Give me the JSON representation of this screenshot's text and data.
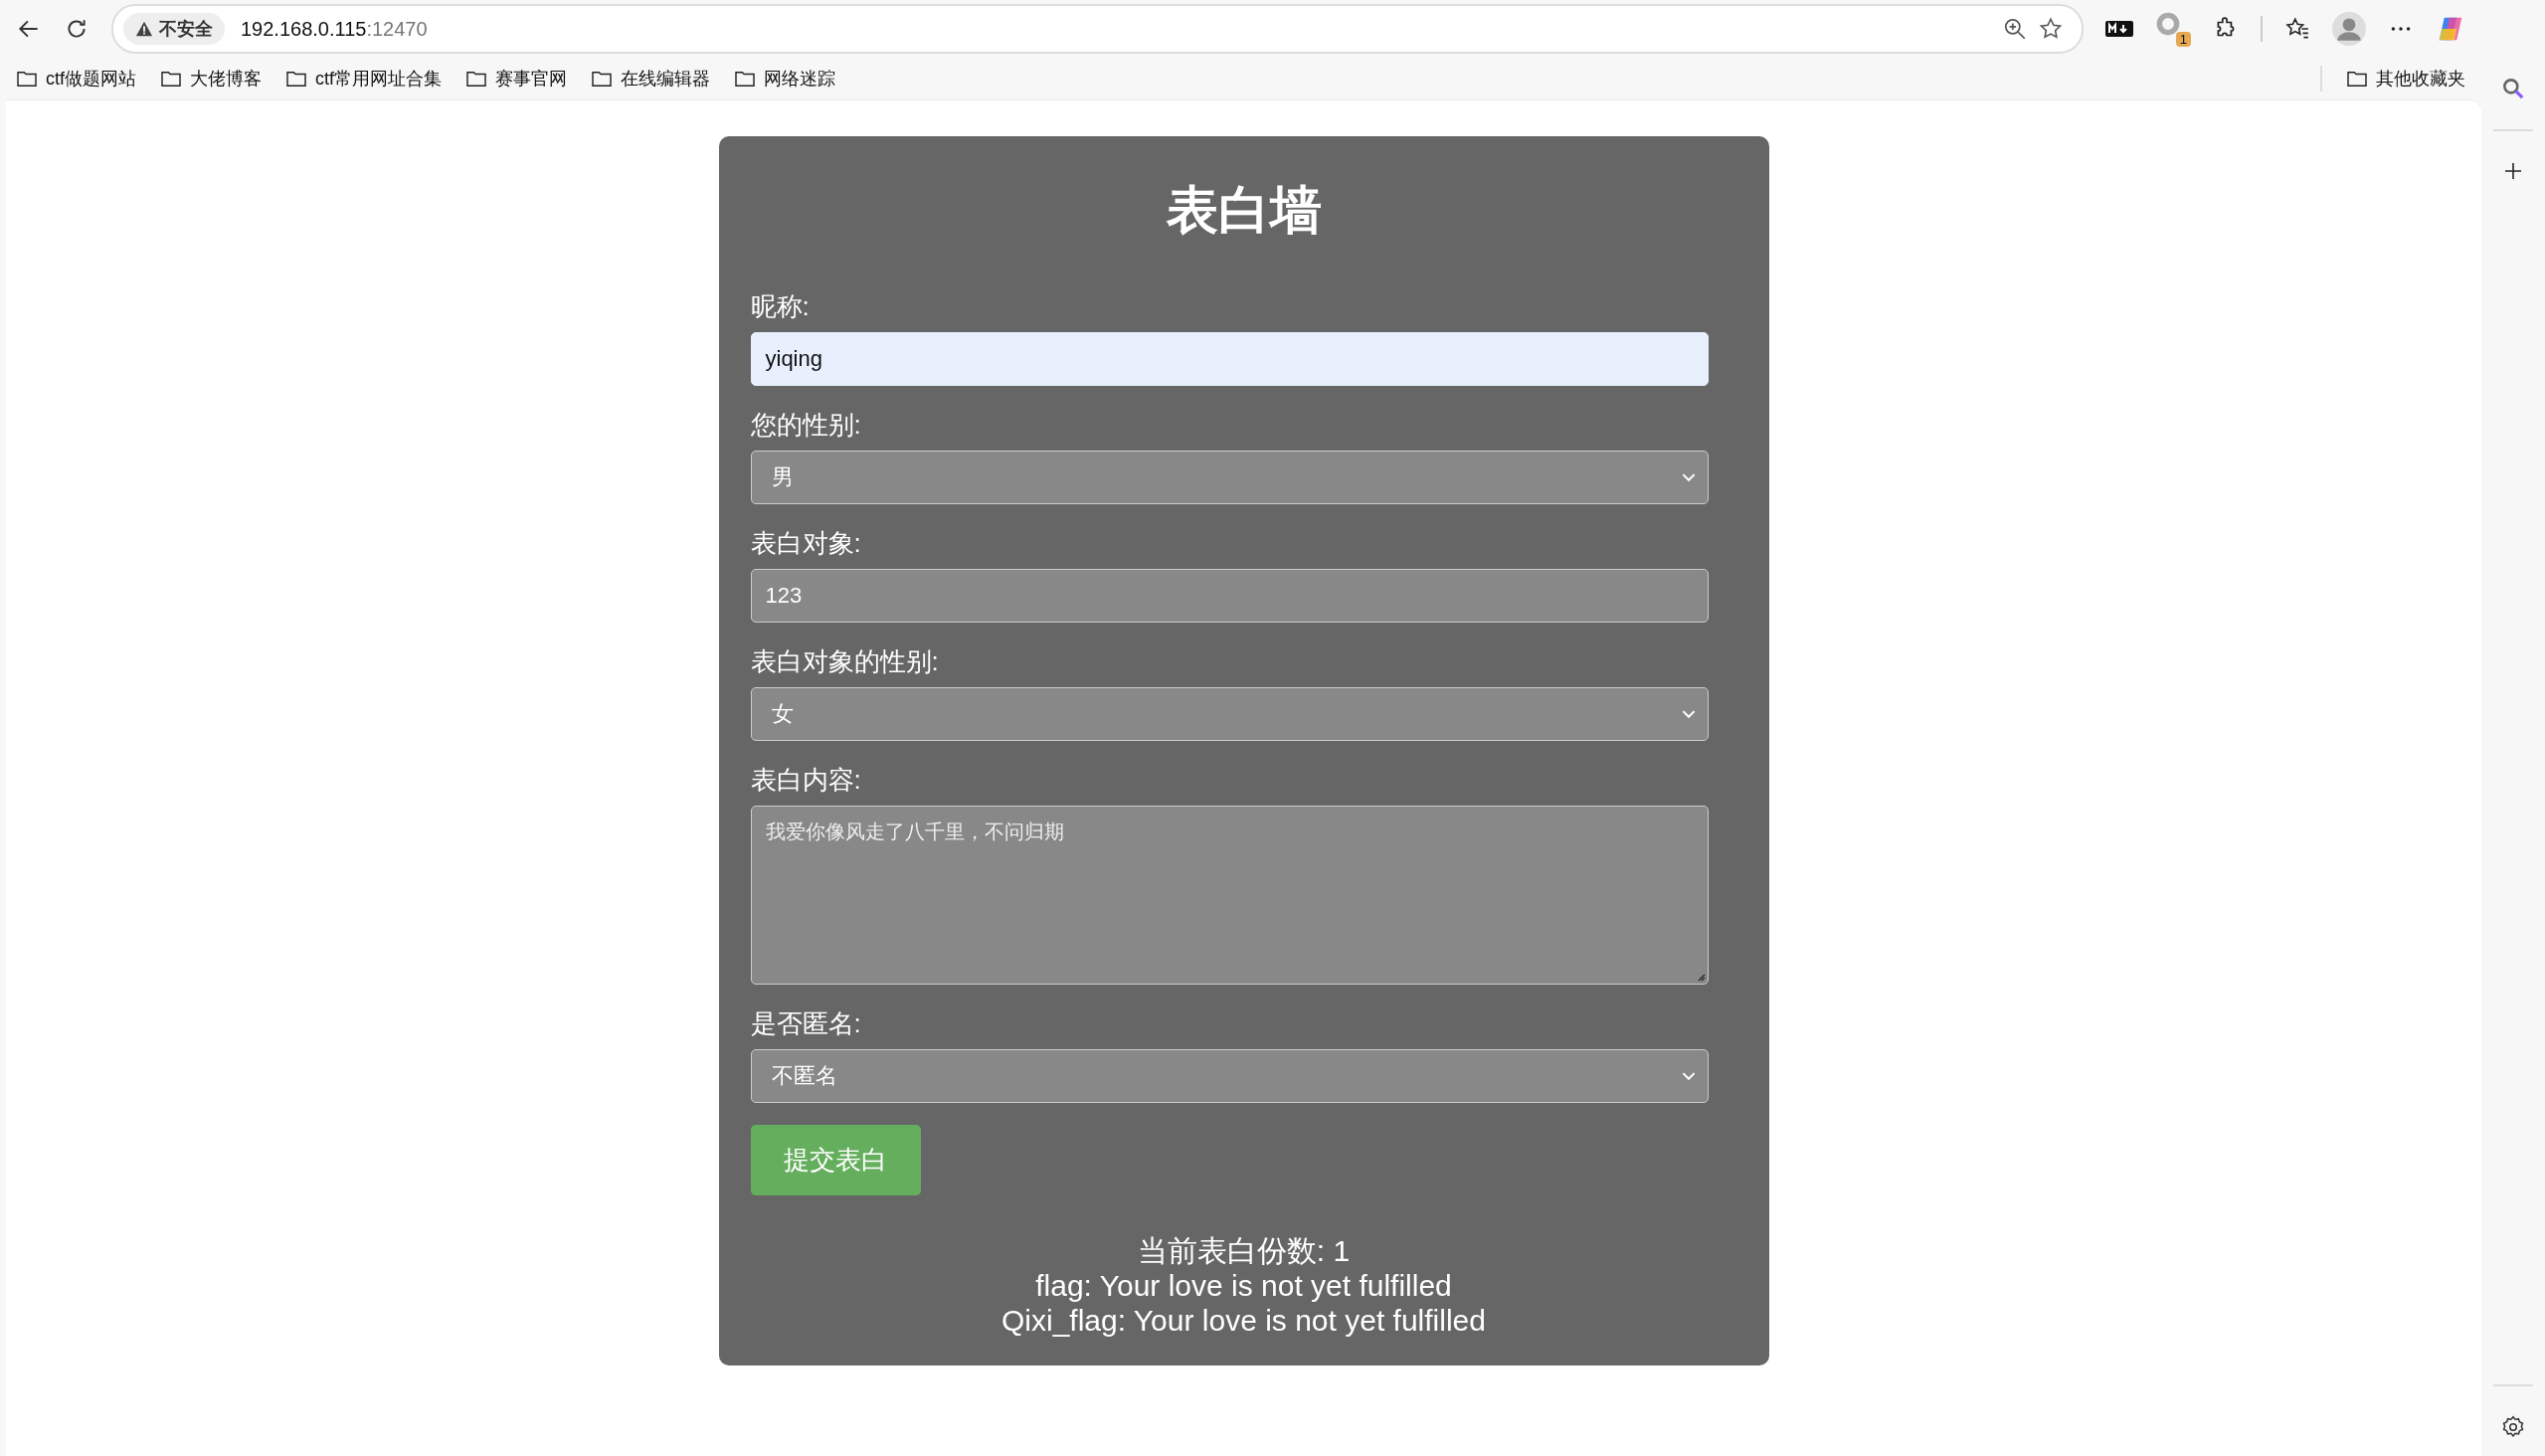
{
  "browser": {
    "security_label": "不安全",
    "url_host": "192.168.0.115",
    "url_port": ":12470",
    "extension_badge": "1",
    "bookmarks": [
      "ctf做题网站",
      "大佬博客",
      "ctf常用网址合集",
      "赛事官网",
      "在线编辑器",
      "网络迷踪"
    ],
    "other_bookmarks": "其他收藏夹"
  },
  "page": {
    "title": "表白墙",
    "fields": [
      {
        "kind": "text",
        "label": "昵称:",
        "value": "yiqing",
        "autofilled": true
      },
      {
        "kind": "select",
        "label": "您的性别:",
        "value": "男"
      },
      {
        "kind": "text",
        "label": "表白对象:",
        "value": "123",
        "autofilled": false
      },
      {
        "kind": "select",
        "label": "表白对象的性别:",
        "value": "女"
      },
      {
        "kind": "textarea",
        "label": "表白内容:",
        "value": "我爱你像风走了八千里，不问归期"
      },
      {
        "kind": "select",
        "label": "是否匿名:",
        "value": "不匿名"
      }
    ],
    "submit_button": "提交表白",
    "results": [
      "当前表白份数: 1",
      "flag: Your love is not yet fulfilled",
      "Qixi_flag: Your love is not yet fulfilled"
    ]
  }
}
